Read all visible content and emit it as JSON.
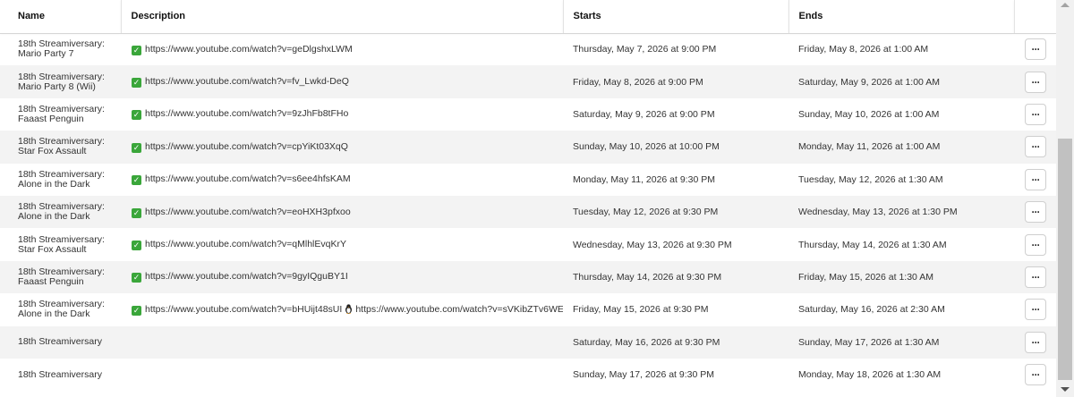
{
  "columns": {
    "name": "Name",
    "description": "Description",
    "starts": "Starts",
    "ends": "Ends"
  },
  "rows": [
    {
      "name": "18th Streamiversary: Mario Party 7",
      "desc": "https://www.youtube.com/watch?v=geDlgshxLWM",
      "check": true,
      "desc2": "",
      "starts": "Thursday, May 7, 2026 at 9:00 PM",
      "ends": "Friday, May 8, 2026 at 1:00 AM"
    },
    {
      "name": "18th Streamiversary: Mario Party 8 (Wii)",
      "desc": "https://www.youtube.com/watch?v=fv_Lwkd-DeQ",
      "check": true,
      "desc2": "",
      "starts": "Friday, May 8, 2026 at 9:00 PM",
      "ends": "Saturday, May 9, 2026 at 1:00 AM"
    },
    {
      "name": "18th Streamiversary: Faaast Penguin",
      "desc": "https://www.youtube.com/watch?v=9zJhFb8tFHo",
      "check": true,
      "desc2": "",
      "starts": "Saturday, May 9, 2026 at 9:00 PM",
      "ends": "Sunday, May 10, 2026 at 1:00 AM"
    },
    {
      "name": "18th Streamiversary: Star Fox Assault",
      "desc": "https://www.youtube.com/watch?v=cpYiKt03XqQ",
      "check": true,
      "desc2": "",
      "starts": "Sunday, May 10, 2026 at 10:00 PM",
      "ends": "Monday, May 11, 2026 at 1:00 AM"
    },
    {
      "name": "18th Streamiversary: Alone in the Dark",
      "desc": "https://www.youtube.com/watch?v=s6ee4hfsKAM",
      "check": true,
      "desc2": "",
      "starts": "Monday, May 11, 2026 at 9:30 PM",
      "ends": "Tuesday, May 12, 2026 at 1:30 AM"
    },
    {
      "name": "18th Streamiversary: Alone in the Dark",
      "desc": "https://www.youtube.com/watch?v=eoHXH3pfxoo",
      "check": true,
      "desc2": "",
      "starts": "Tuesday, May 12, 2026 at 9:30 PM",
      "ends": "Wednesday, May 13, 2026 at 1:30 PM"
    },
    {
      "name": "18th Streamiversary: Star Fox Assault",
      "desc": "https://www.youtube.com/watch?v=qMlhlEvqKrY",
      "check": true,
      "desc2": "",
      "starts": "Wednesday, May 13, 2026 at 9:30 PM",
      "ends": "Thursday, May 14, 2026 at 1:30 AM"
    },
    {
      "name": "18th Streamiversary: Faaast Penguin",
      "desc": "https://www.youtube.com/watch?v=9gyIQguBY1I",
      "check": true,
      "desc2": "",
      "starts": "Thursday, May 14, 2026 at 9:30 PM",
      "ends": "Friday, May 15, 2026 at 1:30 AM"
    },
    {
      "name": "18th Streamiversary: Alone in the Dark",
      "desc": "https://www.youtube.com/watch?v=bHUijt48sUI",
      "check": true,
      "desc2": "https://www.youtube.com/watch?v=sVKibZTv6WE",
      "starts": "Friday, May 15, 2026 at 9:30 PM",
      "ends": "Saturday, May 16, 2026 at 2:30 AM"
    },
    {
      "name": "18th Streamiversary",
      "desc": "",
      "check": false,
      "desc2": "",
      "starts": "Saturday, May 16, 2026 at 9:30 PM",
      "ends": "Sunday, May 17, 2026 at 1:30 AM"
    },
    {
      "name": "18th Streamiversary",
      "desc": "",
      "check": false,
      "desc2": "",
      "starts": "Sunday, May 17, 2026 at 9:30 PM",
      "ends": "Monday, May 18, 2026 at 1:30 AM"
    }
  ],
  "actions": {
    "more_label": "···"
  },
  "icons": {
    "check": "check-icon",
    "penguin": "penguin-icon",
    "more": "more-icon"
  },
  "colors": {
    "check": "#3aa63a",
    "row_alt": "#f3f3f3"
  }
}
